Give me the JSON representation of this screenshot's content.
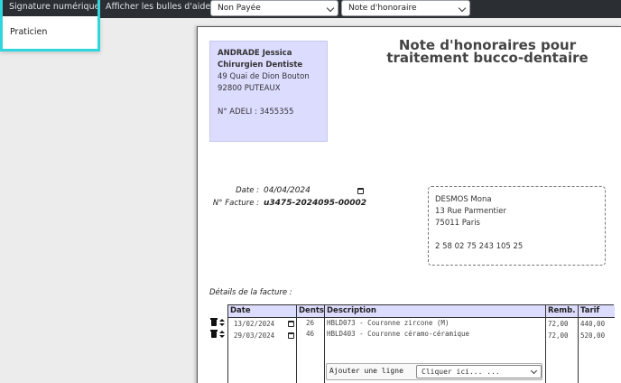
{
  "toolbar": {
    "signature_label": "Signature numérique",
    "help_label": "Afficher les bulles d'aides",
    "payment_select": "Non Payée",
    "document_select": "Note d'honoraire",
    "dropdown_option": "Praticien"
  },
  "accent_color": "#2fd6dd",
  "practitioner": {
    "name": "ANDRADE Jessica",
    "title": "Chirurgien Dentiste",
    "address1": "49 Quai de Dion Bouton",
    "address2": "92800 PUTEAUX",
    "adeli": "N° ADELI : 3455355"
  },
  "document": {
    "title_line1": "Note d'honoraires pour",
    "title_line2": "traitement bucco-dentaire",
    "date_label": "Date :",
    "date_value": "04/04/2024",
    "facture_label": "N° Facture :",
    "facture_value": "u3475-2024095-00002",
    "details_label": "Détails de la facture :"
  },
  "patient": {
    "name": "DESMOS Mona",
    "address1": "13 Rue Parmentier",
    "address2": "75011 Paris",
    "secu": "2 58 02 75 243 105 25"
  },
  "table": {
    "headers": [
      "Date",
      "Dents",
      "Description",
      "Remb.",
      "Tarif"
    ],
    "rows": [
      {
        "date": "13/02/2024",
        "dents": "26",
        "description": "HBLD073 - Couronne zircone (M)",
        "remb": "72,00",
        "tarif": "440,00"
      },
      {
        "date": "29/03/2024",
        "dents": "46",
        "description": "HBLD403 - Couronne céramo-céramique",
        "remb": "72,00",
        "tarif": "520,00"
      }
    ],
    "add_line_label": "Ajouter une ligne",
    "add_line_select": "Cliquer ici... ..."
  }
}
